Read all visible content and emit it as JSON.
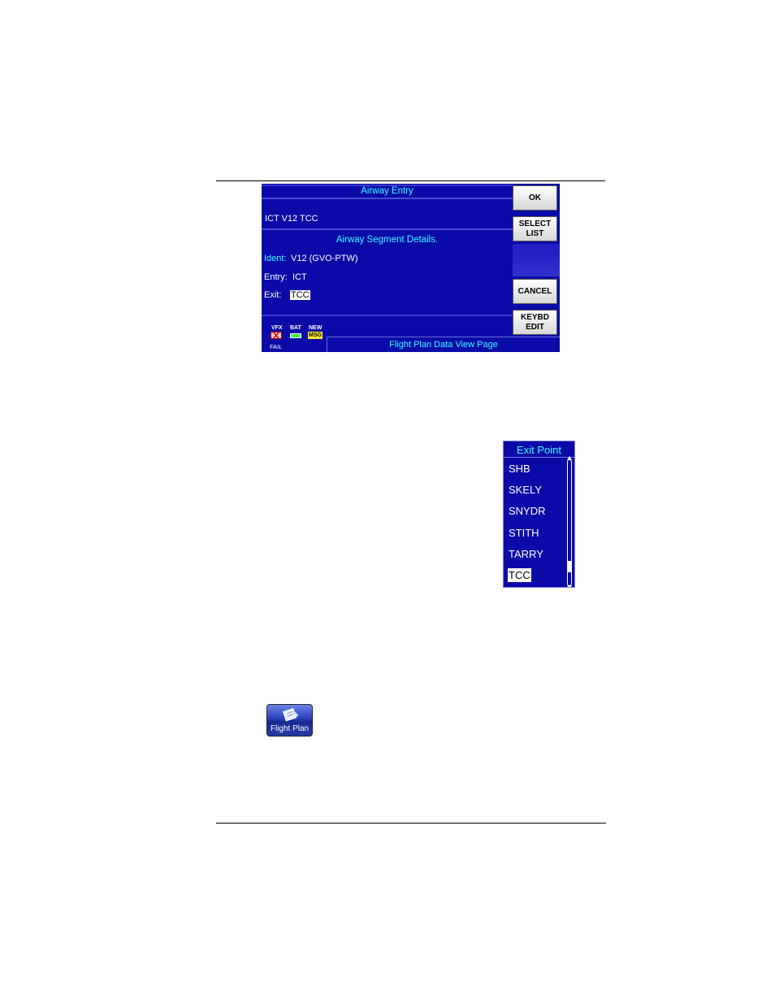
{
  "airway_entry": {
    "title": "Airway Entry",
    "route_text": "ICT V12 TCC",
    "segment_title": "Airway Segment Details.",
    "ident_label": "Ident:",
    "ident_value": "V12 (GVO-PTW)",
    "entry_label": "Entry:",
    "entry_value": "ICT",
    "exit_label": "Exit:",
    "exit_value": "TCC"
  },
  "softkeys": {
    "ok": "OK",
    "select_list": "SELECT\nLIST",
    "cancel": "CANCEL",
    "keybd_edit": "KEYBD\nEDIT"
  },
  "status": {
    "vfx_label": "VFX",
    "vfx_state": "FAIL",
    "bat_label": "BAT",
    "nav_label": "NEW",
    "nav_badge": "MSG"
  },
  "footer": {
    "page_name": "Flight Plan Data View Page"
  },
  "exit_point_list": {
    "title": "Exit Point",
    "items": [
      "SHB",
      "SKELY",
      "SNYDR",
      "STITH",
      "TARRY",
      "TCC"
    ],
    "selected": "TCC"
  },
  "flight_plan_button": {
    "label": "Flight Plan"
  },
  "colors": {
    "screen_bg": "#0a0aa8",
    "accent_cyan": "#33ffff",
    "text_white": "#ffffff"
  }
}
